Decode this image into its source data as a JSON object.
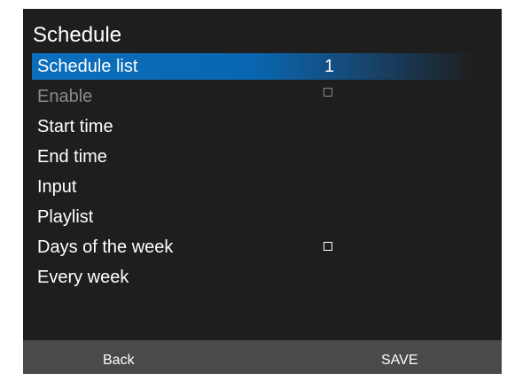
{
  "header": {
    "title": "Schedule"
  },
  "menu": {
    "schedule_list": {
      "label": "Schedule list",
      "value": "1"
    },
    "enable": {
      "label": "Enable"
    },
    "start_time": {
      "label": "Start time"
    },
    "end_time": {
      "label": "End time"
    },
    "input": {
      "label": "Input"
    },
    "playlist": {
      "label": "Playlist"
    },
    "days_of_week": {
      "label": "Days of the week"
    },
    "every_week": {
      "label": "Every week"
    }
  },
  "footer": {
    "back_label": "Back",
    "save_label": "SAVE"
  },
  "colors": {
    "background": "#1e1e1e",
    "selection": "#0c6fbd",
    "footer": "#4a4a4a",
    "text": "#ffffff",
    "disabled_text": "#8a8a8a"
  }
}
